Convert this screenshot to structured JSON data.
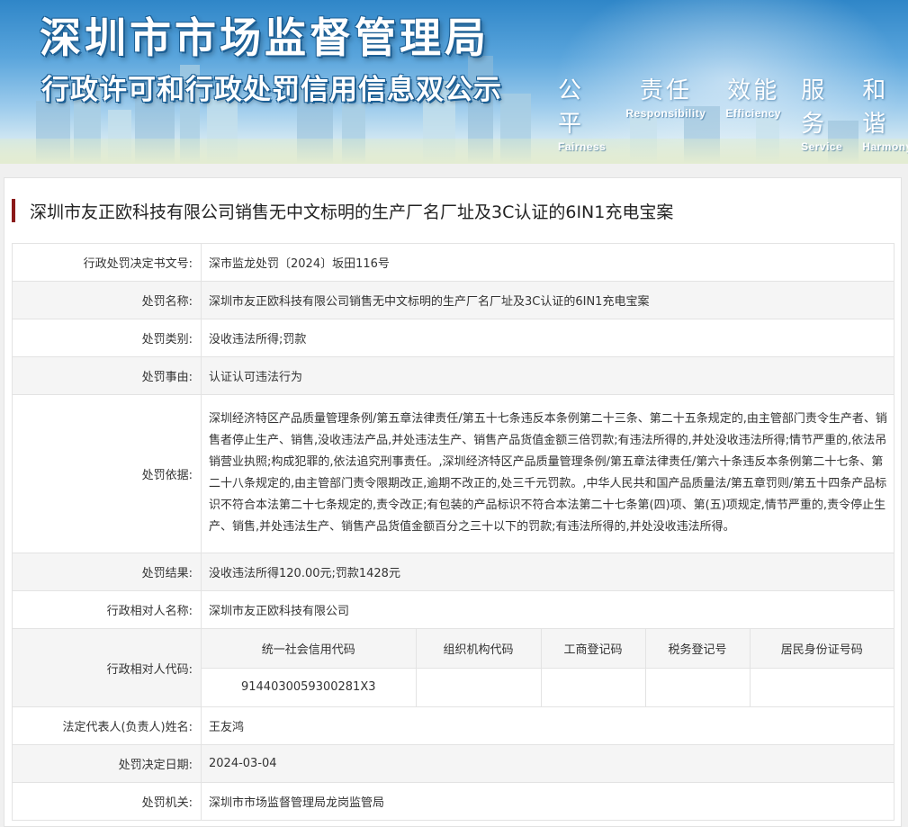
{
  "banner": {
    "title_main": "深圳市市场监督管理局",
    "title_sub": "行政许可和行政处罚信用信息双公示",
    "slogans": [
      {
        "zh": "公平",
        "en": "Fairness"
      },
      {
        "zh": "责任",
        "en": "Responsibility"
      },
      {
        "zh": "效能",
        "en": "Efficiency"
      },
      {
        "zh": "服务",
        "en": "Service"
      },
      {
        "zh": "和谐",
        "en": "Harmony"
      }
    ]
  },
  "case_title": "深圳市友正欧科技有限公司销售无中文标明的生产厂名厂址及3C认证的6IN1充电宝案",
  "rows": {
    "decision_no": {
      "label": "行政处罚决定书文号:",
      "value": "深市监龙处罚〔2024〕坂田116号"
    },
    "penalty_name": {
      "label": "处罚名称:",
      "value": "深圳市友正欧科技有限公司销售无中文标明的生产厂名厂址及3C认证的6IN1充电宝案"
    },
    "penalty_type": {
      "label": "处罚类别:",
      "value": "没收违法所得;罚款"
    },
    "penalty_reason": {
      "label": "处罚事由:",
      "value": "认证认可违法行为"
    },
    "penalty_basis": {
      "label": "处罚依据:",
      "value": "深圳经济特区产品质量管理条例/第五章法律责任/第五十七条违反本条例第二十三条、第二十五条规定的,由主管部门责令生产者、销售者停止生产、销售,没收违法产品,并处违法生产、销售产品货值金额三倍罚款;有违法所得的,并处没收违法所得;情节严重的,依法吊销营业执照;构成犯罪的,依法追究刑事责任。,深圳经济特区产品质量管理条例/第五章法律责任/第六十条违反本条例第二十七条、第二十八条规定的,由主管部门责令限期改正,逾期不改正的,处三千元罚款。,中华人民共和国产品质量法/第五章罚则/第五十四条产品标识不符合本法第二十七条规定的,责令改正;有包装的产品标识不符合本法第二十七条第(四)项、第(五)项规定,情节严重的,责令停止生产、销售,并处违法生产、销售产品货值金额百分之三十以下的罚款;有违法所得的,并处没收违法所得。"
    },
    "penalty_result": {
      "label": "处罚结果:",
      "value": "没收违法所得120.00元;罚款1428元"
    },
    "party_name": {
      "label": "行政相对人名称:",
      "value": "深圳市友正欧科技有限公司"
    },
    "party_code": {
      "label": "行政相对人代码:",
      "headers": [
        "统一社会信用代码",
        "组织机构代码",
        "工商登记码",
        "税务登记号",
        "居民身份证号码"
      ],
      "values": [
        "9144030059300281X3",
        "",
        "",
        "",
        ""
      ]
    },
    "legal_rep": {
      "label": "法定代表人(负责人)姓名:",
      "value": "王友鸿"
    },
    "decision_date": {
      "label": "处罚决定日期:",
      "value": "2024-03-04"
    },
    "authority": {
      "label": "处罚机关:",
      "value": "深圳市市场监督管理局龙岗监管局"
    }
  },
  "colors": {
    "title_accent": "#8b1a1a",
    "row_alt": "#f5f5f5",
    "border": "#e3e3e3"
  }
}
